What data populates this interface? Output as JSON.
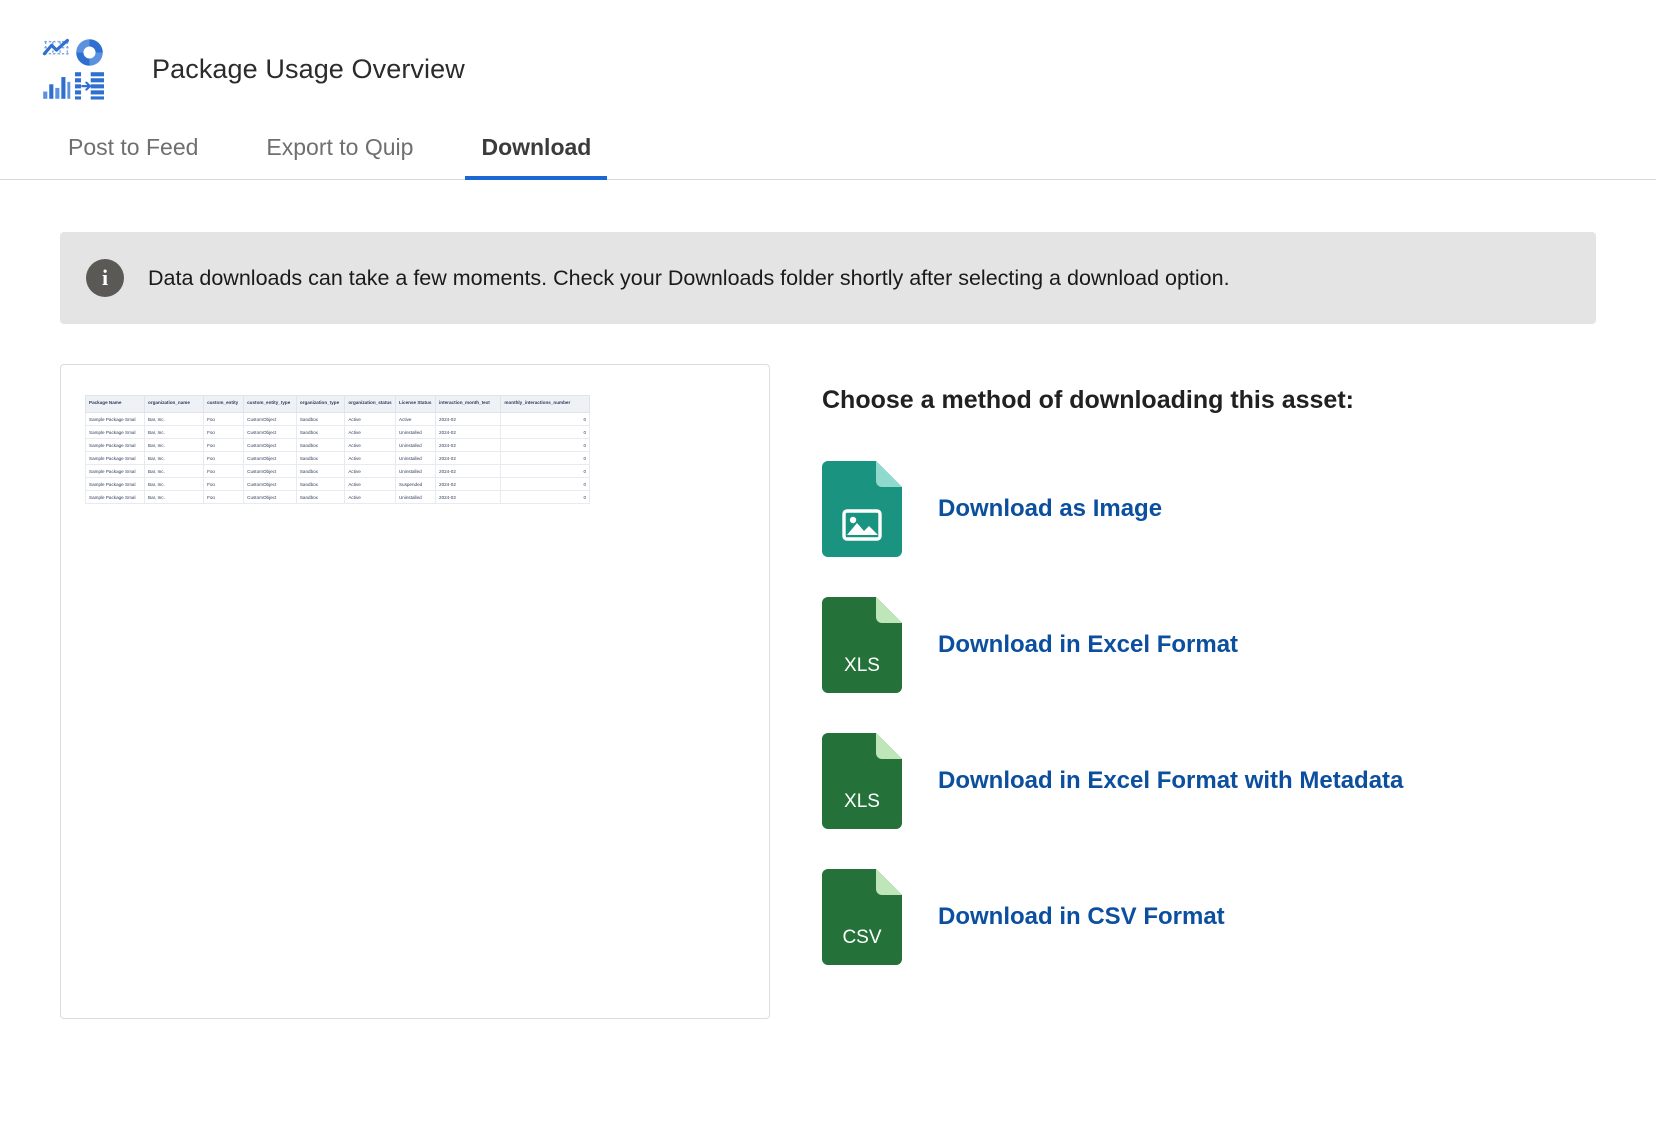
{
  "header": {
    "title": "Package Usage Overview",
    "logo_icons": [
      "line-chart-icon",
      "donut-chart-icon",
      "bar-chart-icon",
      "funnel-chart-icon"
    ]
  },
  "tabs": [
    {
      "label": "Post to Feed",
      "active": false
    },
    {
      "label": "Export to Quip",
      "active": false
    },
    {
      "label": "Download",
      "active": true
    }
  ],
  "banner": {
    "icon": "info-icon",
    "icon_glyph": "i",
    "message": "Data downloads can take a few moments. Check your Downloads folder shortly after selecting a download option."
  },
  "preview": {
    "columns": [
      "Package Name",
      "organization_name",
      "custom_entity",
      "custom_entity_type",
      "organization_type",
      "organization_status",
      "License Status",
      "interaction_month_text",
      "monthly_interactions_number"
    ],
    "rows": [
      [
        "Sample Package Smal",
        "Bar, Inc.",
        "Foo",
        "CustomObject",
        "Sandbox",
        "Active",
        "Active",
        "2024-02",
        "0"
      ],
      [
        "Sample Package Smal",
        "Bar, Inc.",
        "Foo",
        "CustomObject",
        "Sandbox",
        "Active",
        "Uninstalled",
        "2024-02",
        "0"
      ],
      [
        "Sample Package Smal",
        "Bar, Inc.",
        "Foo",
        "CustomObject",
        "Sandbox",
        "Active",
        "Uninstalled",
        "2024-02",
        "0"
      ],
      [
        "Sample Package Smal",
        "Bar, Inc.",
        "Foo",
        "CustomObject",
        "Sandbox",
        "Active",
        "Uninstalled",
        "2024-02",
        "0"
      ],
      [
        "Sample Package Smal",
        "Bar, Inc.",
        "Foo",
        "CustomObject",
        "Sandbox",
        "Active",
        "Uninstalled",
        "2024-02",
        "0"
      ],
      [
        "Sample Package Smal",
        "Bar, Inc.",
        "Foo",
        "CustomObject",
        "Sandbox",
        "Active",
        "Suspended",
        "2024-02",
        "0"
      ],
      [
        "Sample Package Smal",
        "Bar, Inc.",
        "Foo",
        "CustomObject",
        "Sandbox",
        "Active",
        "Uninstalled",
        "2024-02",
        "0"
      ]
    ]
  },
  "download": {
    "heading": "Choose a method of downloading this asset:",
    "options": [
      {
        "label": "Download as Image",
        "icon": "image-file-icon",
        "badge": "",
        "color": "#1a9381",
        "fold_color": "#8fd9cd"
      },
      {
        "label": "Download in Excel Format",
        "icon": "xls-file-icon",
        "badge": "XLS",
        "color": "#24723a",
        "fold_color": "#bfe6b9"
      },
      {
        "label": "Download in Excel Format with Metadata",
        "icon": "xls-file-icon",
        "badge": "XLS",
        "color": "#24723a",
        "fold_color": "#bfe6b9"
      },
      {
        "label": "Download in CSV Format",
        "icon": "csv-file-icon",
        "badge": "CSV",
        "color": "#24723a",
        "fold_color": "#bfe6b9"
      }
    ]
  },
  "colors": {
    "accent_blue": "#1b68d4",
    "link_blue": "#0b4f9e",
    "banner_bg": "#e4e4e4",
    "logo_blue": "#3a76cf"
  }
}
